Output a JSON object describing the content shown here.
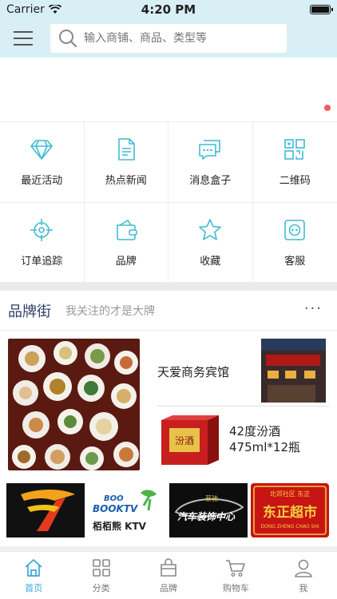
{
  "status": {
    "carrier": "Carrier",
    "time": "4:20 PM"
  },
  "search": {
    "placeholder": "输入商铺、商品、类型等"
  },
  "grid": [
    {
      "label": "最近活动",
      "icon": "diamond-icon"
    },
    {
      "label": "热点新闻",
      "icon": "document-icon"
    },
    {
      "label": "消息盒子",
      "icon": "message-icon"
    },
    {
      "label": "二维码",
      "icon": "qrcode-icon"
    },
    {
      "label": "订单追踪",
      "icon": "target-icon"
    },
    {
      "label": "品牌",
      "icon": "wallet-icon"
    },
    {
      "label": "收藏",
      "icon": "star-icon"
    },
    {
      "label": "客服",
      "icon": "service-icon"
    }
  ],
  "brand": {
    "title": "品牌街",
    "subtitle": "我关注的才是大牌",
    "more": "···",
    "hotel": "天爱商务宾馆",
    "wine_line1": "42度汾酒",
    "wine_line2": "475ml*12瓶",
    "wine_box_text": "汾酒",
    "logo2_top": "BOO",
    "logo2_mid": "BOOKTV",
    "logo2_bottom": "栢栢熊 KTV",
    "logo3_top": "蔡驰",
    "logo3_bottom": "汽车装饰中心",
    "logo4_top": "北郊社区 东正",
    "logo4_main": "东正超市",
    "logo4_pinyin": "DONG ZHENG CHAO SHI"
  },
  "tabs": [
    {
      "label": "首页",
      "icon": "home-icon"
    },
    {
      "label": "分类",
      "icon": "category-icon"
    },
    {
      "label": "品牌",
      "icon": "bag-icon"
    },
    {
      "label": "购物车",
      "icon": "cart-icon"
    },
    {
      "label": "我",
      "icon": "user-icon"
    }
  ],
  "colors": {
    "accent": "#3aa8d8",
    "header_bg": "#d8eff5",
    "brand_title": "#2d3e62",
    "dot": "#f05a5a"
  }
}
